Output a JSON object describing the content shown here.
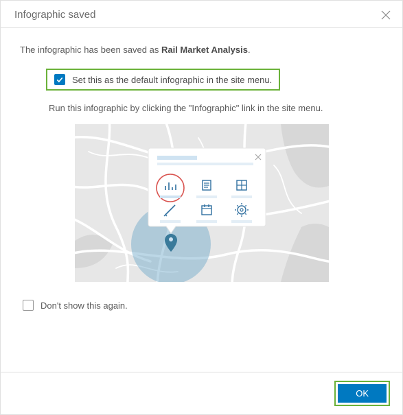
{
  "header": {
    "title": "Infographic saved"
  },
  "body": {
    "intro_prefix": "The infographic has been saved as ",
    "intro_name": "Rail Market Analysis",
    "intro_suffix": ".",
    "default_checkbox_label": "Set this as the default infographic in the site menu.",
    "hint": "Run this infographic by clicking the \"Infographic\" link in the site menu.",
    "dont_show_label": "Don't show this again."
  },
  "footer": {
    "ok_label": "OK"
  },
  "icons": {
    "close": "close-icon",
    "checkbox_checked": "checkbox-checked-icon",
    "checkbox_unchecked": "checkbox-unchecked-icon"
  },
  "colors": {
    "accent": "#0079c1",
    "highlight_border": "#6bb23a",
    "map_bg": "#e7e7e7",
    "map_road": "#ffffff",
    "popup_bg": "#ffffff",
    "popup_accent": "#cfe3f2",
    "popup_icon": "#2f6f9f",
    "circle_ring": "#d9534f",
    "radius_fill": "#6aa7c8"
  }
}
